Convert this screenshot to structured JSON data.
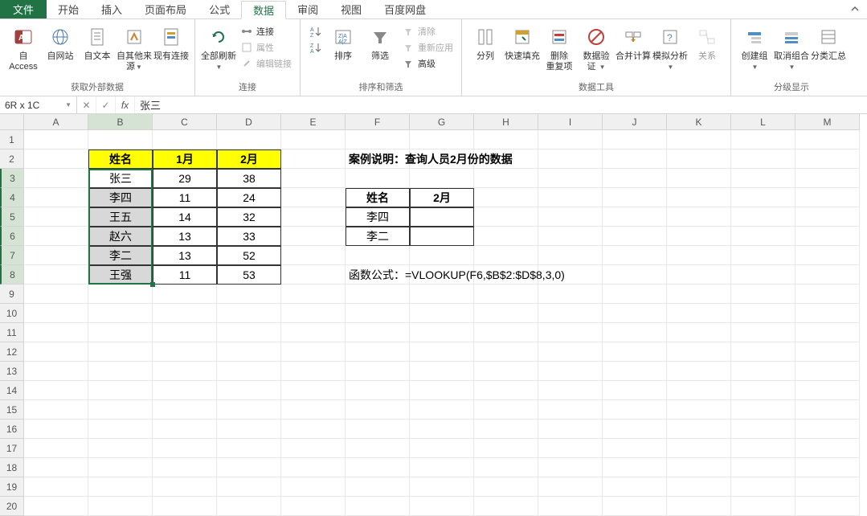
{
  "menu": {
    "file": "文件",
    "tabs": [
      "开始",
      "插入",
      "页面布局",
      "公式",
      "数据",
      "审阅",
      "视图",
      "百度网盘"
    ],
    "active_index": 4
  },
  "ribbon": {
    "groups": [
      {
        "label": "获取外部数据",
        "big": [
          {
            "name": "from-access",
            "label": "自 Access"
          },
          {
            "name": "from-web",
            "label": "自网站"
          },
          {
            "name": "from-text",
            "label": "自文本"
          },
          {
            "name": "from-other",
            "label": "自其他来源",
            "dropdown": true
          },
          {
            "name": "existing-conn",
            "label": "现有连接"
          }
        ]
      },
      {
        "label": "连接",
        "big": [
          {
            "name": "refresh-all",
            "label": "全部刷新",
            "dropdown": true
          }
        ],
        "small": [
          {
            "name": "connections",
            "label": "连接"
          },
          {
            "name": "properties",
            "label": "属性"
          },
          {
            "name": "edit-links",
            "label": "编辑链接"
          }
        ]
      },
      {
        "label": "排序和筛选",
        "big": [
          {
            "name": "sort-az",
            "label": ""
          },
          {
            "name": "sort",
            "label": "排序"
          },
          {
            "name": "filter",
            "label": "筛选"
          }
        ],
        "small": [
          {
            "name": "clear",
            "label": "清除"
          },
          {
            "name": "reapply",
            "label": "重新应用"
          },
          {
            "name": "advanced",
            "label": "高级"
          }
        ]
      },
      {
        "label": "数据工具",
        "big": [
          {
            "name": "text-to-cols",
            "label": "分列"
          },
          {
            "name": "flash-fill",
            "label": "快速填充"
          },
          {
            "name": "remove-dup",
            "label": "删除\n重复项"
          },
          {
            "name": "data-valid",
            "label": "数据验\n证",
            "dropdown": true
          },
          {
            "name": "consolidate",
            "label": "合并计算"
          },
          {
            "name": "what-if",
            "label": "模拟分析",
            "dropdown": true
          },
          {
            "name": "relationships",
            "label": "关系"
          }
        ]
      },
      {
        "label": "分级显示",
        "big": [
          {
            "name": "group",
            "label": "创建组",
            "dropdown": true
          },
          {
            "name": "ungroup",
            "label": "取消组合",
            "dropdown": true
          },
          {
            "name": "subtotal",
            "label": "分类汇总"
          }
        ]
      }
    ]
  },
  "formula_bar": {
    "name_box": "6R x 1C",
    "formula": "张三"
  },
  "columns": [
    "A",
    "B",
    "C",
    "D",
    "E",
    "F",
    "G",
    "H",
    "I",
    "J",
    "K",
    "L",
    "M"
  ],
  "rows": [
    1,
    2,
    3,
    4,
    5,
    6,
    7,
    8,
    9,
    10,
    11,
    12,
    13,
    14,
    15,
    16,
    17,
    18,
    19,
    20
  ],
  "table_main": {
    "headers": [
      "姓名",
      "1月",
      "2月"
    ],
    "rows": [
      [
        "张三",
        "29",
        "38"
      ],
      [
        "李四",
        "11",
        "24"
      ],
      [
        "王五",
        "14",
        "32"
      ],
      [
        "赵六",
        "13",
        "33"
      ],
      [
        "李二",
        "13",
        "52"
      ],
      [
        "王强",
        "11",
        "53"
      ]
    ]
  },
  "case_text": "案例说明：查询人员2月份的数据",
  "lookup_table": {
    "headers": [
      "姓名",
      "2月"
    ],
    "rows": [
      [
        "李四",
        ""
      ],
      [
        "李二",
        ""
      ]
    ]
  },
  "formula_text_label": "函数公式：",
  "formula_text": "=VLOOKUP(F6,$B$2:$D$8,3,0)"
}
